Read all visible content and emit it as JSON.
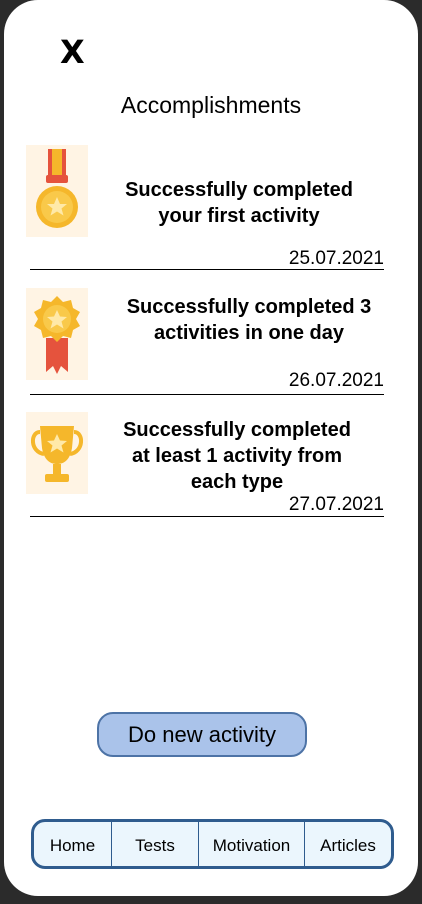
{
  "header": {
    "close_label": "X",
    "title": "Accomplishments"
  },
  "accomplishments": [
    {
      "icon": "gold-medal-icon",
      "lines": [
        "Successfully completed",
        "your first activity"
      ],
      "date": "25.07.2021"
    },
    {
      "icon": "badge-ribbon-icon",
      "lines": [
        "Successfully completed 3",
        "activities in one day"
      ],
      "date": "26.07.2021"
    },
    {
      "icon": "trophy-icon",
      "lines": [
        "Successfully completed",
        "at least 1 activity from",
        "each type"
      ],
      "date": "27.07.2021"
    }
  ],
  "cta_label": "Do new activity",
  "nav": {
    "items": [
      "Home",
      "Tests",
      "Motivation",
      "Articles"
    ]
  },
  "colors": {
    "cta_bg": "#aac3ea",
    "cta_border": "#4d73a6",
    "nav_border": "#2f5c8e",
    "nav_bg": "#ebf6fd",
    "gold": "#f5b72b",
    "ribbon": "#e5533d"
  }
}
